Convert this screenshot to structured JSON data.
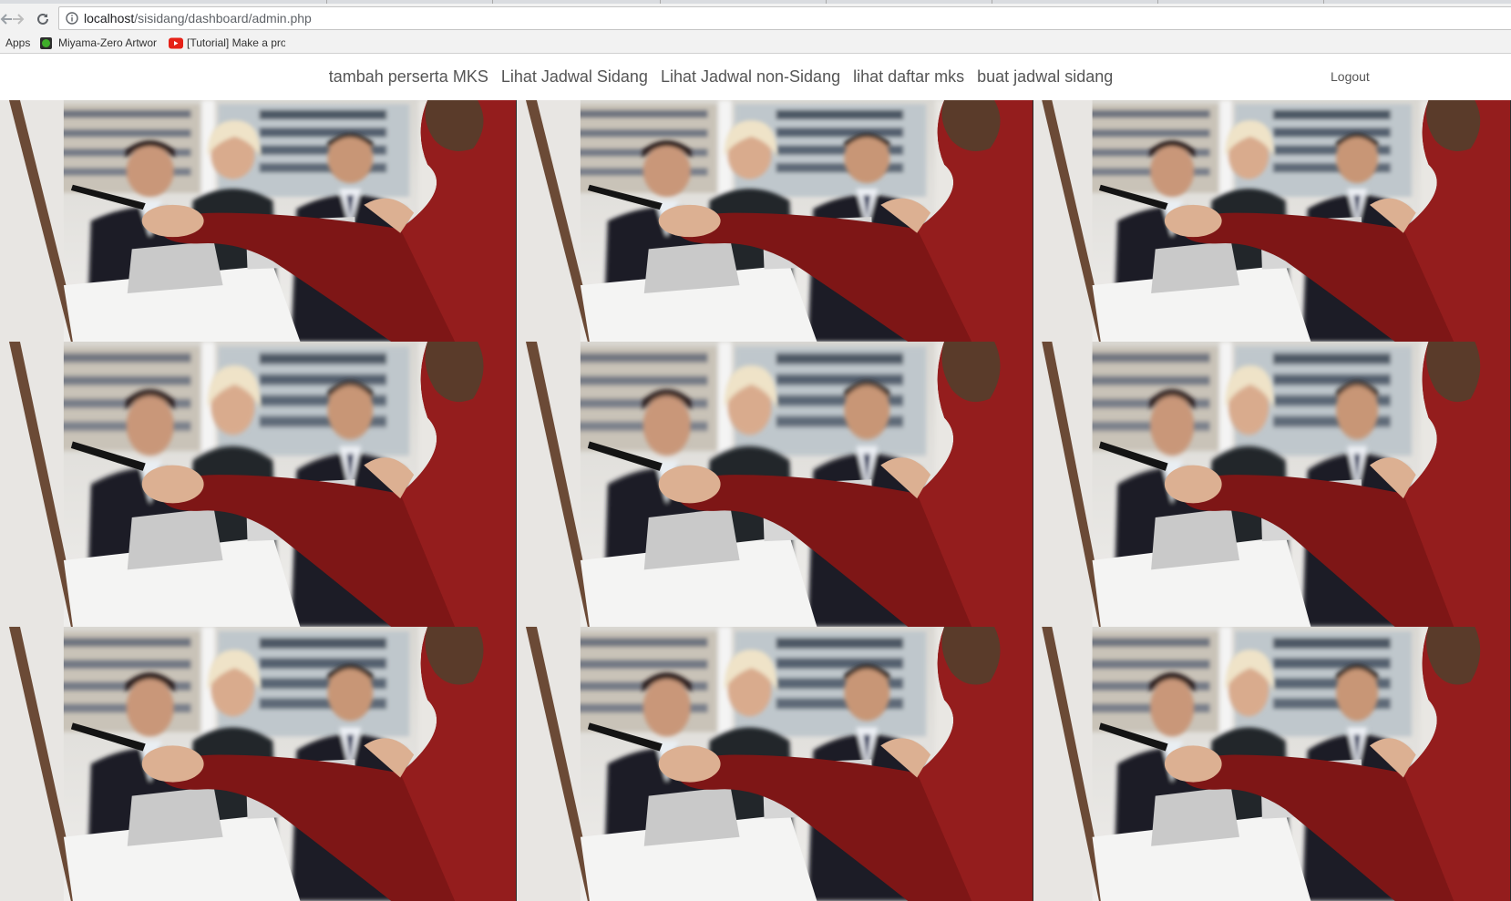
{
  "browser": {
    "url_host": "localhost",
    "url_path": "/sisidang/dashboard/admin.php",
    "bookmarks": [
      {
        "label": "Apps",
        "icon": "apps-icon"
      },
      {
        "label": "Miyama-Zero Artwork",
        "icon": "green-favicon-icon"
      },
      {
        "label": "[Tutorial] Make a proj",
        "icon": "youtube-icon"
      }
    ]
  },
  "nav": {
    "links": [
      "tambah perserta MKS",
      "Lihat Jadwal Sidang",
      "Lihat Jadwal non-Sidang",
      "lihat daftar mks",
      "buat jadwal sidang"
    ],
    "logout": "Logout"
  },
  "hero": {
    "image_subject": "presenter-meeting-photo",
    "tile_count": 9
  },
  "colors": {
    "nav_text": "#555555",
    "jacket_red": "#8b1a1a",
    "toolbar_bg": "#f2f2f2"
  }
}
